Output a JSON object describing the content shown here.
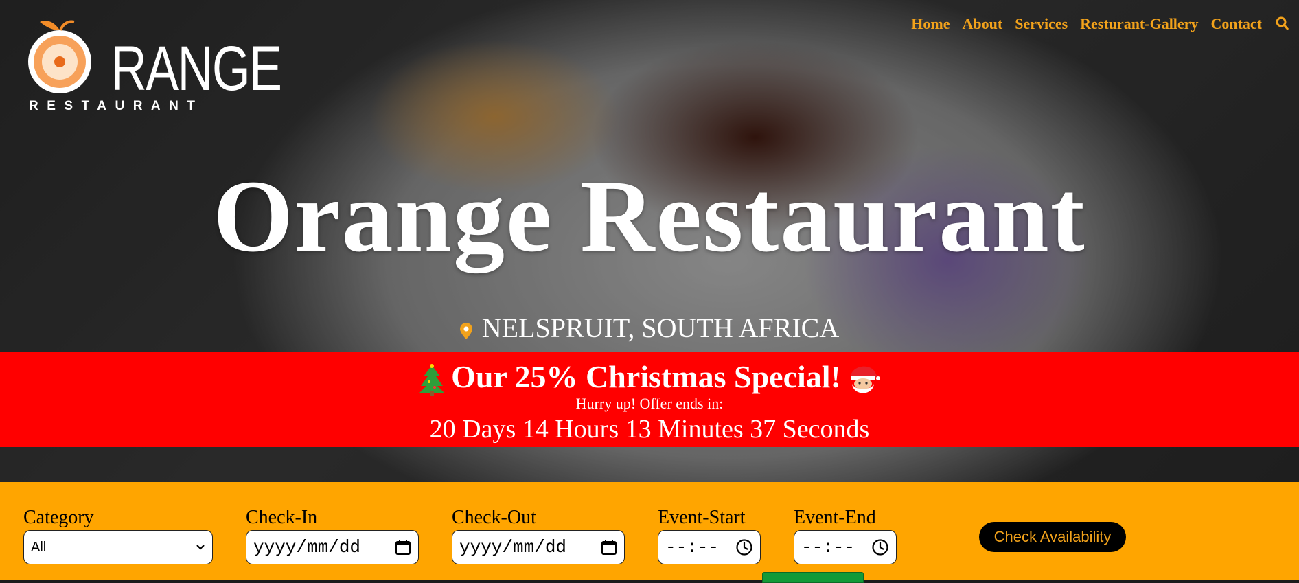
{
  "logo": {
    "word": "RANGE",
    "sub": "RESTAURANT"
  },
  "nav": [
    "Home",
    "About",
    "Services",
    "Resturant-Gallery",
    "Contact"
  ],
  "hero": {
    "title": "Orange Restaurant",
    "location": "NELSPRUIT, SOUTH AFRICA"
  },
  "promo": {
    "title": "Our 25% Christmas Special!",
    "subtitle": "Hurry up! Offer ends in:",
    "countdown": "20 Days 14 Hours 13 Minutes 37 Seconds"
  },
  "form": {
    "category_label": "Category",
    "category_value": "All",
    "checkin_label": "Check-In",
    "checkin_placeholder": "yyyy/mm/dd",
    "checkout_label": "Check-Out",
    "checkout_placeholder": "yyyy/mm/dd",
    "event_start_label": "Event-Start",
    "event_start_placeholder": "--:--",
    "event_end_label": "Event-End",
    "event_end_placeholder": "--:--",
    "check_button": "Check Availability"
  },
  "colors": {
    "accent": "#f2a21b",
    "promo_bg": "#ff0000",
    "bar_bg": "#ffa500"
  }
}
